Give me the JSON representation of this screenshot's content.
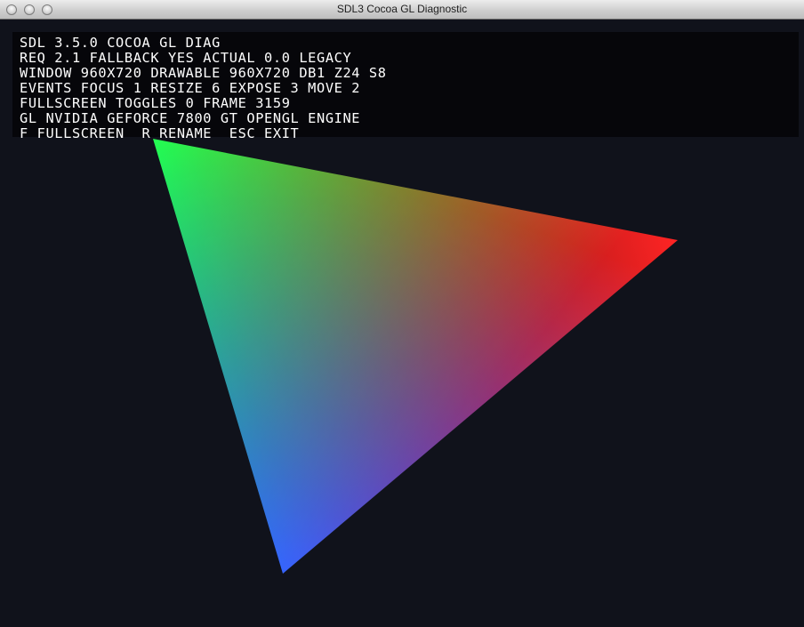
{
  "window": {
    "title": "SDL3 Cocoa GL Diagnostic"
  },
  "hud": {
    "lines": [
      "SDL 3.5.0 COCOA GL DIAG",
      "REQ 2.1 FALLBACK YES ACTUAL 0.0 LEGACY",
      "WINDOW 960X720 DRAWABLE 960X720 DB1 Z24 S8",
      "EVENTS FOCUS 1 RESIZE 6 EXPOSE 3 MOVE 2",
      "FULLSCREEN TOGGLES 0 FRAME 3159",
      "GL NVIDIA GEFORCE 7800 GT OPENGL ENGINE",
      "F FULLSCREEN  R RENAME  ESC EXIT"
    ]
  },
  "scene": {
    "background_color": "#10121b",
    "vertex_colors": {
      "top_left": "#20ff40",
      "right": "#ff2424",
      "bottom": "#3050ff"
    }
  }
}
